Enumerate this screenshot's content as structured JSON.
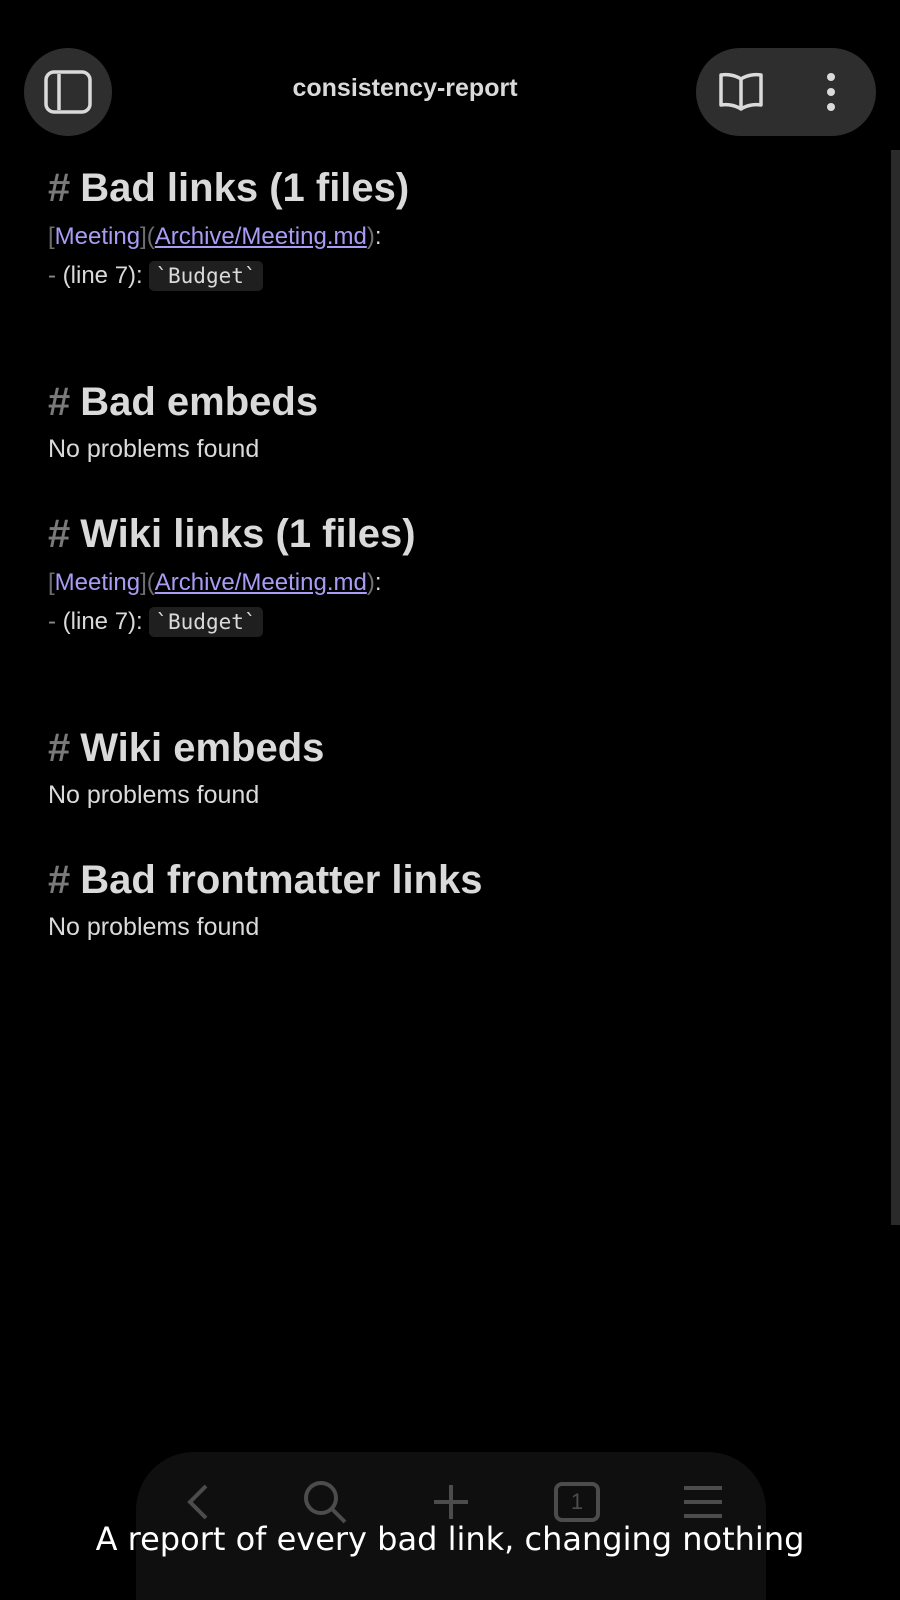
{
  "header": {
    "title": "consistency-report"
  },
  "sections": [
    {
      "heading": "Bad links (1 files)",
      "link": {
        "text": "Meeting",
        "url": "Archive/Meeting.md"
      },
      "item": {
        "prefix": "- ",
        "line": "(line 7): ",
        "code": "`Budget`"
      }
    },
    {
      "heading": "Bad embeds",
      "message": "No problems found"
    },
    {
      "heading": "Wiki links (1 files)",
      "link": {
        "text": "Meeting",
        "url": "Archive/Meeting.md"
      },
      "item": {
        "prefix": "- ",
        "line": "(line 7): ",
        "code": "`Budget`"
      }
    },
    {
      "heading": "Wiki embeds",
      "message": "No problems found"
    },
    {
      "heading": "Bad frontmatter links",
      "message": "No problems found"
    }
  ],
  "markdown": {
    "hash": "#",
    "open_bracket": "[",
    "close_bracket": "]",
    "open_paren": "(",
    "close_paren": ")",
    "colon": ":"
  },
  "bottom_nav": {
    "tab_count": "1"
  },
  "caption": "A report of every bad link, changing nothing",
  "icons": {
    "sidebar": "sidebar-toggle-icon",
    "reading_view": "book-open-icon",
    "more": "more-vertical-icon",
    "back": "chevron-left-icon",
    "search": "search-icon",
    "new": "plus-icon",
    "tabs": "tabs-count-icon",
    "menu": "menu-icon"
  },
  "colors": {
    "background": "#000000",
    "text": "#dadada",
    "link": "#a99cf4",
    "muted": "#6e6e6e",
    "button_bg": "#2e2e2e"
  }
}
